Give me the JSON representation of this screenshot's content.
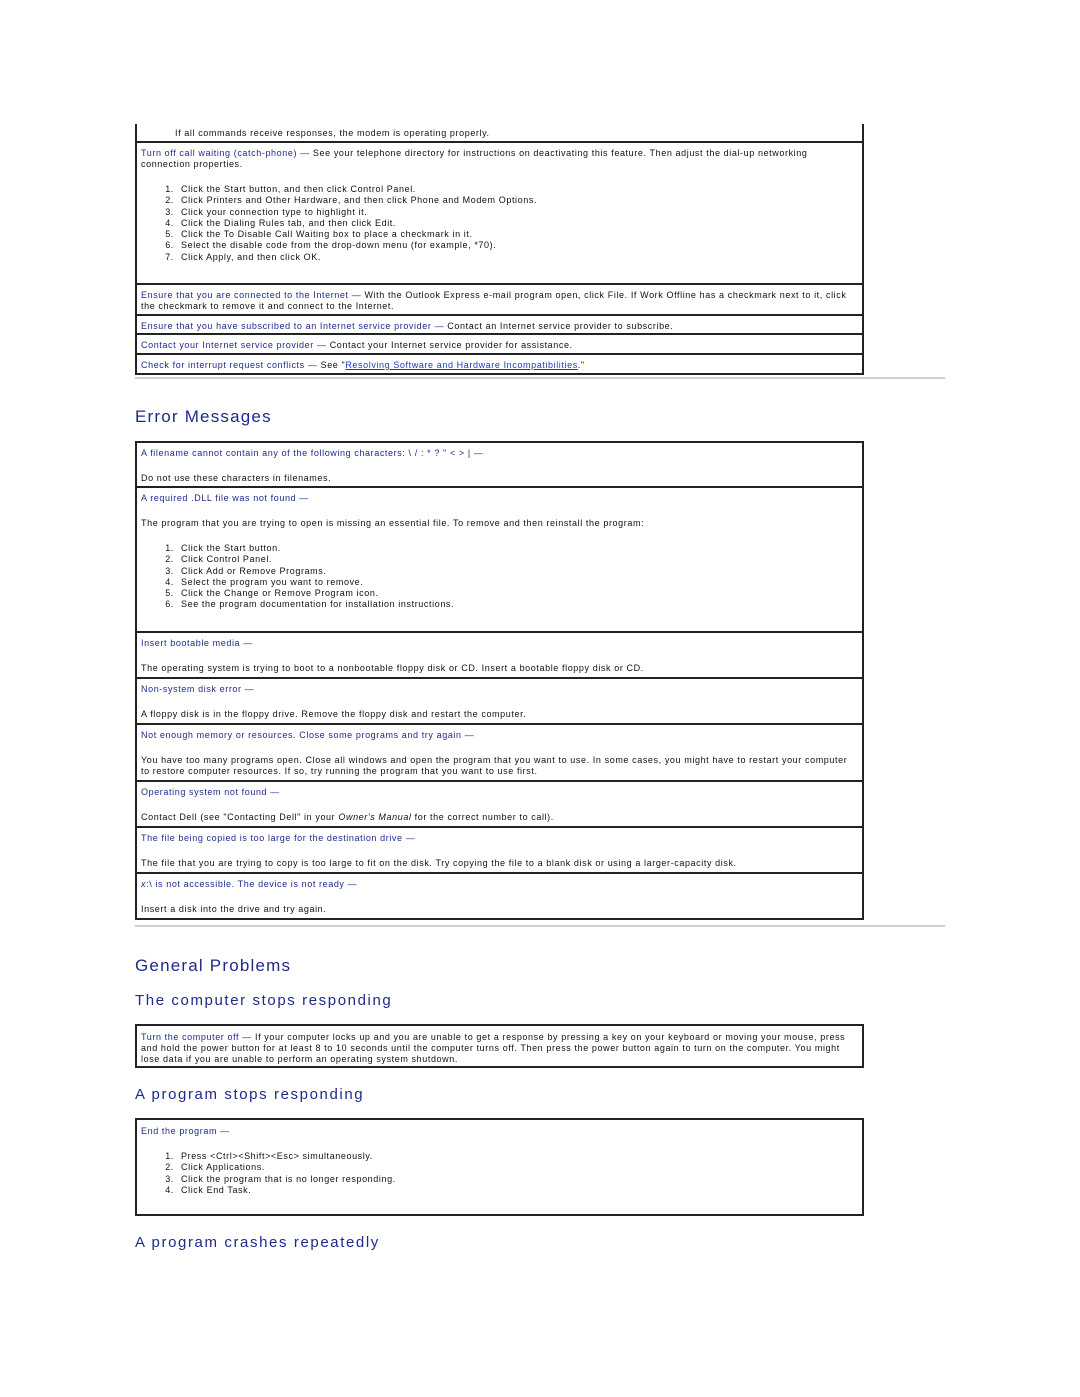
{
  "modem_section": {
    "intro_note": "If all commands receive responses, the modem is operating properly.",
    "rows": [
      {
        "term": "Turn off call waiting (catch-phone)",
        "desc": "See your telephone directory for instructions on deactivating this feature. Then adjust the dial-up networking connection properties.",
        "steps": [
          "Click the Start button, and then click Control Panel.",
          "Click Printers and Other Hardware, and then click Phone and Modem Options.",
          "Click your connection type to highlight it.",
          "Click the Dialing Rules tab, and then click Edit.",
          "Click the To Disable Call Waiting box to place a checkmark in it.",
          "Select the disable code from the drop-down menu (for example, *70).",
          "Click Apply, and then click OK."
        ]
      },
      {
        "term": "Ensure that you are connected to the Internet",
        "desc": "With the Outlook Express e-mail program open, click File. If Work Offline has a checkmark next to it, click the checkmark to remove it and connect to the Internet."
      },
      {
        "term": "Ensure that you have subscribed to an Internet service provider",
        "desc": "Contact an Internet service provider to subscribe."
      },
      {
        "term": "Contact your Internet service provider",
        "desc": "Contact your Internet service provider for assistance."
      },
      {
        "term": "Check for interrupt request conflicts",
        "desc_prefix": "See \"",
        "link_text": "Resolving Software and Hardware Incompatibilities",
        "desc_suffix": ".\""
      }
    ]
  },
  "error_messages": {
    "title": "Error Messages",
    "rows": [
      {
        "term": "A filename cannot contain any of the following characters: \\ / : * ? \" < > |",
        "desc": "Do not use these characters in filenames."
      },
      {
        "term": "A required .DLL file was not found",
        "desc": "The program that you are trying to open is missing an essential file. To remove and then reinstall the program:",
        "steps": [
          "Click the Start button.",
          "Click Control Panel.",
          "Click Add or Remove Programs.",
          "Select the program you want to remove.",
          "Click the Change or Remove Program icon.",
          "See the program documentation for installation instructions."
        ]
      },
      {
        "term": "Insert bootable media",
        "desc": "The operating system is trying to boot to a nonbootable floppy disk or CD. Insert a bootable floppy disk or CD."
      },
      {
        "term": "Non-system disk error",
        "desc": "A floppy disk is in the floppy drive. Remove the floppy disk and restart the computer."
      },
      {
        "term": "Not enough memory or resources. Close some programs and try again",
        "desc": "You have too many programs open. Close all windows and open the program that you want to use. In some cases, you might have to restart your computer to restore computer resources. If so, try running the program that you want to use first."
      },
      {
        "term": "Operating system not found",
        "desc_prefix": "Contact Dell (see \"Contacting Dell\" in your ",
        "desc_italic": "Owner's Manual",
        "desc_suffix": " for the correct number to call)."
      },
      {
        "term": "The file being copied is too large for the destination drive",
        "desc": "The file that you are trying to copy is too large to fit on the disk. Try copying the file to a blank disk or using a larger-capacity disk."
      },
      {
        "term_italic": "x",
        "term": ":\\  is not accessible. The device is not ready",
        "desc": "Insert a disk into the drive and try again."
      }
    ]
  },
  "general_problems": {
    "title": "General Problems",
    "computer_stops": {
      "title": "The computer stops responding",
      "term": "Turn the computer off",
      "desc": "If your computer locks up and you are unable to get a response by pressing a key on your keyboard or moving your mouse, press and hold the power button for at least 8 to 10 seconds until the computer turns off. Then press the power button again to turn on the computer. You might lose data if you are unable to perform an operating system shutdown."
    },
    "program_stops": {
      "title": "A program stops responding",
      "term": "End the program",
      "steps": [
        "Press <Ctrl><Shift><Esc> simultaneously.",
        "Click Applications.",
        "Click the program that is no longer responding.",
        "Click End Task."
      ]
    },
    "program_crashes": {
      "title": "A program crashes repeatedly"
    }
  },
  "dash": "—"
}
